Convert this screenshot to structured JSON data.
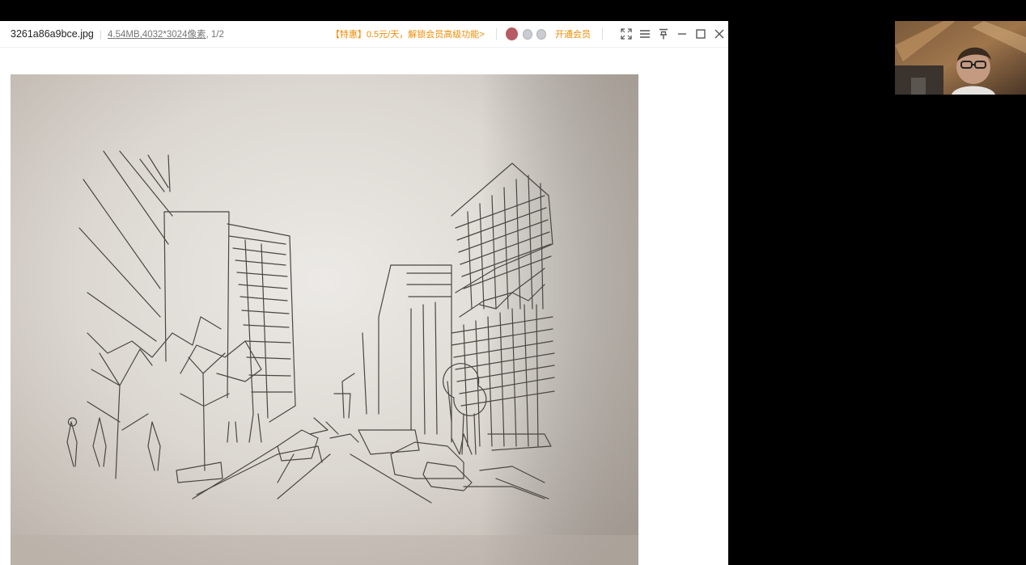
{
  "viewer": {
    "filename": "3261a86a9bce.jpg",
    "filesize": "4.54MB",
    "resolution": ",4032*3024像素",
    "page_counter": ", 1/2",
    "promo": "【特惠】0.5元/天，解锁会员高级功能>",
    "vip_label": "开通会员",
    "icons": {
      "user_avatar": "avatar-icon",
      "gem_left": "gem-icon",
      "gem_right": "coin-icon",
      "fullscreen": "fullscreen-icon",
      "menu": "menu-icon",
      "pin": "pin-icon",
      "minimize": "minimize-icon",
      "maximize": "maximize-icon",
      "close": "close-icon"
    },
    "colors": {
      "accent": "#f08a00",
      "avatar": "#b75a63"
    }
  },
  "image": {
    "subject": "pencil sketch"
  },
  "webcam": {
    "visible": true
  }
}
